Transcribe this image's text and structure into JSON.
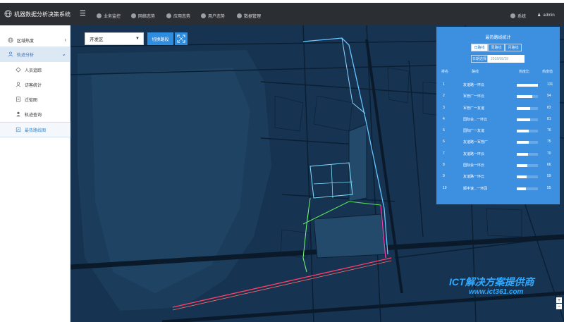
{
  "app": {
    "title": "机器数据分析决策系统"
  },
  "topnav": [
    {
      "label": "业务监控"
    },
    {
      "label": "网络态势"
    },
    {
      "label": "应用态势"
    },
    {
      "label": "用户态势"
    },
    {
      "label": "数据管理"
    }
  ],
  "topright": {
    "system": "系统",
    "user": "admin"
  },
  "sidebar": {
    "group1": "区域热度",
    "group2": "轨迹分析",
    "items": [
      {
        "label": "人员追踪"
      },
      {
        "label": "访客统计"
      },
      {
        "label": "迁徙图"
      },
      {
        "label": "轨迹查询"
      },
      {
        "label": "最热路线图"
      }
    ]
  },
  "toolbar": {
    "district": "开发区",
    "switch_label": "切换路段"
  },
  "panel": {
    "title": "最热路线统计",
    "tabs": [
      "日路线",
      "周路线",
      "月路线"
    ],
    "date_label": "日期选择",
    "date_value": "2018/08/28",
    "headers": [
      "排名",
      "路线",
      "热度比",
      "热度值"
    ],
    "rows": [
      {
        "rank": "1",
        "route": "友谊路一环云",
        "ratio": 1.0,
        "value": "131"
      },
      {
        "rank": "2",
        "route": "军管厂一环云",
        "ratio": 0.72,
        "value": "94"
      },
      {
        "rank": "3",
        "route": "军管厂一友谊",
        "ratio": 0.63,
        "value": "83"
      },
      {
        "rank": "4",
        "route": "国际会...一环云",
        "ratio": 0.62,
        "value": "81"
      },
      {
        "rank": "5",
        "route": "国际厂一友谊",
        "ratio": 0.58,
        "value": "76"
      },
      {
        "rank": "6",
        "route": "友谊路一军管厂",
        "ratio": 0.57,
        "value": "75"
      },
      {
        "rank": "7",
        "route": "友谊路一环云",
        "ratio": 0.53,
        "value": "70"
      },
      {
        "rank": "8",
        "route": "国际会一环云",
        "ratio": 0.5,
        "value": "66"
      },
      {
        "rank": "9",
        "route": "友谊路一环云",
        "ratio": 0.45,
        "value": "59"
      },
      {
        "rank": "10",
        "route": "顺丰速...一环园",
        "ratio": 0.42,
        "value": "55"
      }
    ]
  },
  "watermark": {
    "text": "ICT解决方案提供商",
    "url": "www.ict361.com"
  },
  "zoom": {
    "in": "+",
    "out": "−"
  },
  "colors": {
    "topbar": "#2b2f33",
    "accent": "#2f8de0",
    "panel": "#3d8fe0",
    "map_bg": "#15304a"
  }
}
